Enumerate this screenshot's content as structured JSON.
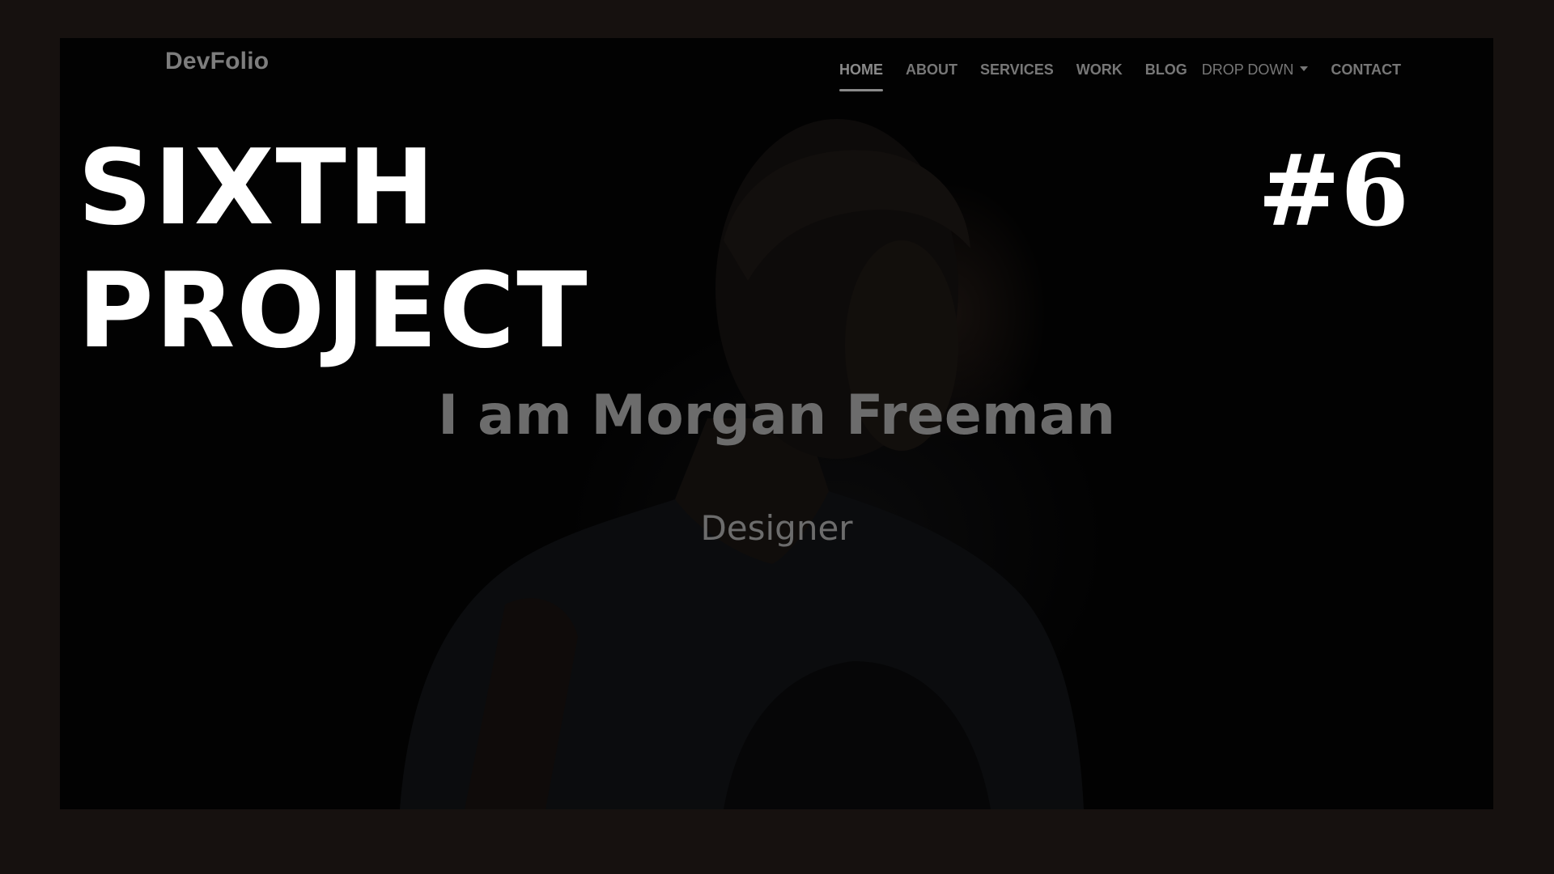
{
  "nav": {
    "brand": "DevFolio",
    "items": [
      {
        "label": "HOME",
        "active": true
      },
      {
        "label": "ABOUT",
        "active": false
      },
      {
        "label": "SERVICES",
        "active": false
      },
      {
        "label": "WORK",
        "active": false
      },
      {
        "label": "BLOG",
        "active": false
      },
      {
        "label": "DROP DOWN",
        "active": false,
        "dropdown": true
      },
      {
        "label": "CONTACT",
        "active": false
      }
    ]
  },
  "hero": {
    "name_line": "I am Morgan Freeman",
    "role": "Designer"
  },
  "thumbnail_overlay": {
    "title_line1": "SIXTH",
    "title_line2": "PROJECT",
    "number": "#6"
  },
  "colors": {
    "outer_border": "#16110f",
    "hero_background": "#040404",
    "overlay_text": "#ffffff",
    "muted_text": "#6c6c6c",
    "nav_text": "#777777"
  }
}
